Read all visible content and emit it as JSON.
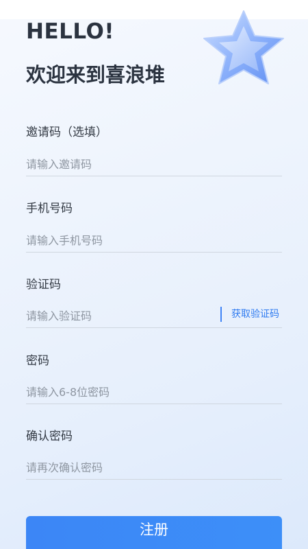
{
  "header": {
    "greeting": "HELLO!",
    "welcome": "欢迎来到喜浪堆"
  },
  "form": {
    "invite": {
      "label": "邀请码（选填）",
      "placeholder": "请输入邀请码"
    },
    "phone": {
      "label": "手机号码",
      "placeholder": "请输入手机号码"
    },
    "code": {
      "label": "验证码",
      "placeholder": "请输入验证码",
      "action": "获取验证码"
    },
    "password": {
      "label": "密码",
      "placeholder": "请输入6-8位密码"
    },
    "confirm": {
      "label": "确认密码",
      "placeholder": "请再次确认密码"
    },
    "submit": "注册"
  },
  "theme": {
    "accent": "#3c86f6",
    "text": "#2b3340",
    "placeholder": "#8e96a1",
    "divider": "#cfd6df"
  },
  "icons": {
    "decoration": "star-icon"
  }
}
